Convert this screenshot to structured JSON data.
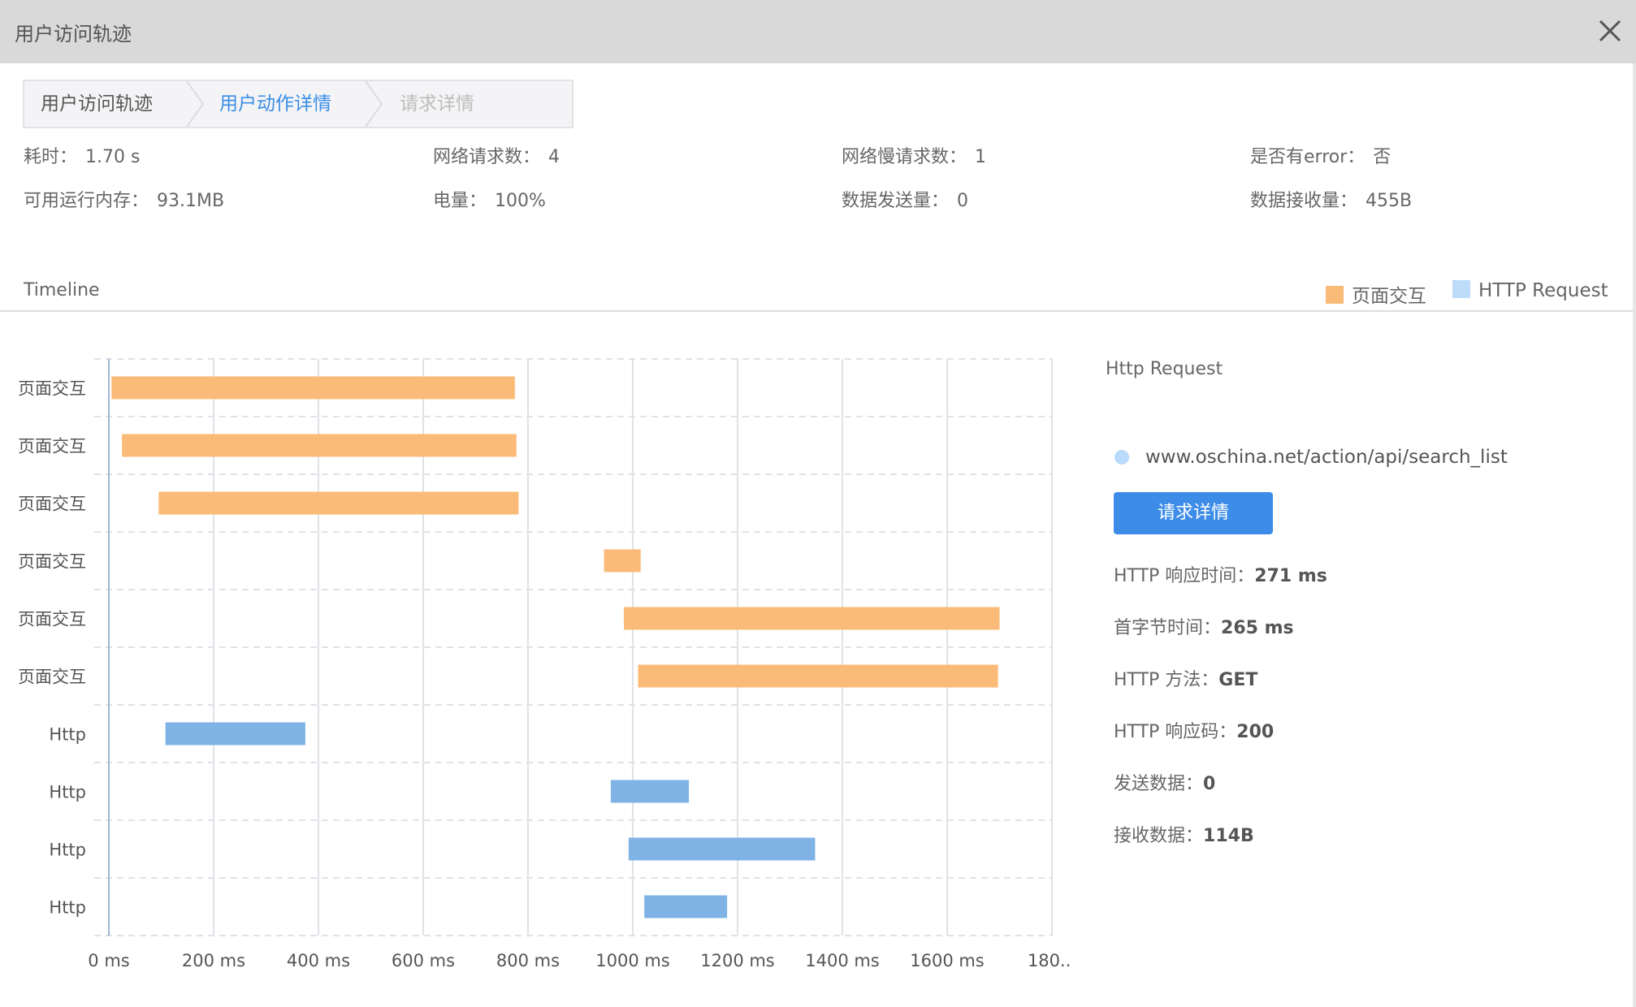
{
  "window": {
    "title": "用户访问轨迹"
  },
  "breadcrumb": {
    "items": [
      {
        "label": "用户访问轨迹"
      },
      {
        "label": "用户动作详情"
      },
      {
        "label": "请求详情"
      }
    ]
  },
  "stats": {
    "row1": [
      {
        "label": "耗时：",
        "value": "1.70 s"
      },
      {
        "label": "网络请求数：",
        "value": "4"
      },
      {
        "label": "网络慢请求数：",
        "value": "1"
      },
      {
        "label": "是否有error：",
        "value": "否"
      }
    ],
    "row2": [
      {
        "label": "可用运行内存：",
        "value": "93.1MB"
      },
      {
        "label": "电量：",
        "value": "100%"
      },
      {
        "label": "数据发送量：",
        "value": "0"
      },
      {
        "label": "数据接收量：",
        "value": "455B"
      }
    ]
  },
  "timeline": {
    "title": "Timeline",
    "legend": [
      {
        "label": "页面交互",
        "color": "#fbbb78"
      },
      {
        "label": "HTTP Request",
        "color": "#bcdcfa"
      }
    ]
  },
  "chart_data": {
    "type": "bar",
    "orientation": "horizontal-range",
    "categories": [
      "页面交互",
      "页面交互",
      "页面交互",
      "页面交互",
      "页面交互",
      "页面交互",
      "Http",
      "Http",
      "Http",
      "Http"
    ],
    "series": [
      {
        "name": "页面交互",
        "color": "#fbbb78",
        "ranges": [
          [
            5,
            775
          ],
          [
            25,
            778
          ],
          [
            95,
            782
          ],
          [
            945,
            1015
          ],
          [
            983,
            1700
          ],
          [
            1010,
            1697
          ]
        ]
      },
      {
        "name": "HTTP Request",
        "color": "#7fb3e6",
        "ranges": [
          [
            108,
            375
          ],
          [
            958,
            1107
          ],
          [
            992,
            1348
          ],
          [
            1022,
            1180
          ]
        ]
      }
    ],
    "xlim": [
      0,
      1800
    ],
    "xticks": [
      "0 ms",
      "200 ms",
      "400 ms",
      "600 ms",
      "800 ms",
      "1000 ms",
      "1200 ms",
      "1400 ms",
      "1600 ms",
      "180..."
    ],
    "grid": true
  },
  "detail": {
    "title": "Http Request",
    "url": "www.oschina.net/action/api/search_list",
    "button": "请求详情",
    "items": [
      {
        "label": "HTTP 响应时间：",
        "value": "271 ms"
      },
      {
        "label": "首字节时间：",
        "value": "265 ms"
      },
      {
        "label": "HTTP 方法：",
        "value": "GET"
      },
      {
        "label": "HTTP 响应码：",
        "value": "200"
      },
      {
        "label": "发送数据：",
        "value": "0"
      },
      {
        "label": "接收数据：",
        "value": "114B"
      }
    ]
  }
}
